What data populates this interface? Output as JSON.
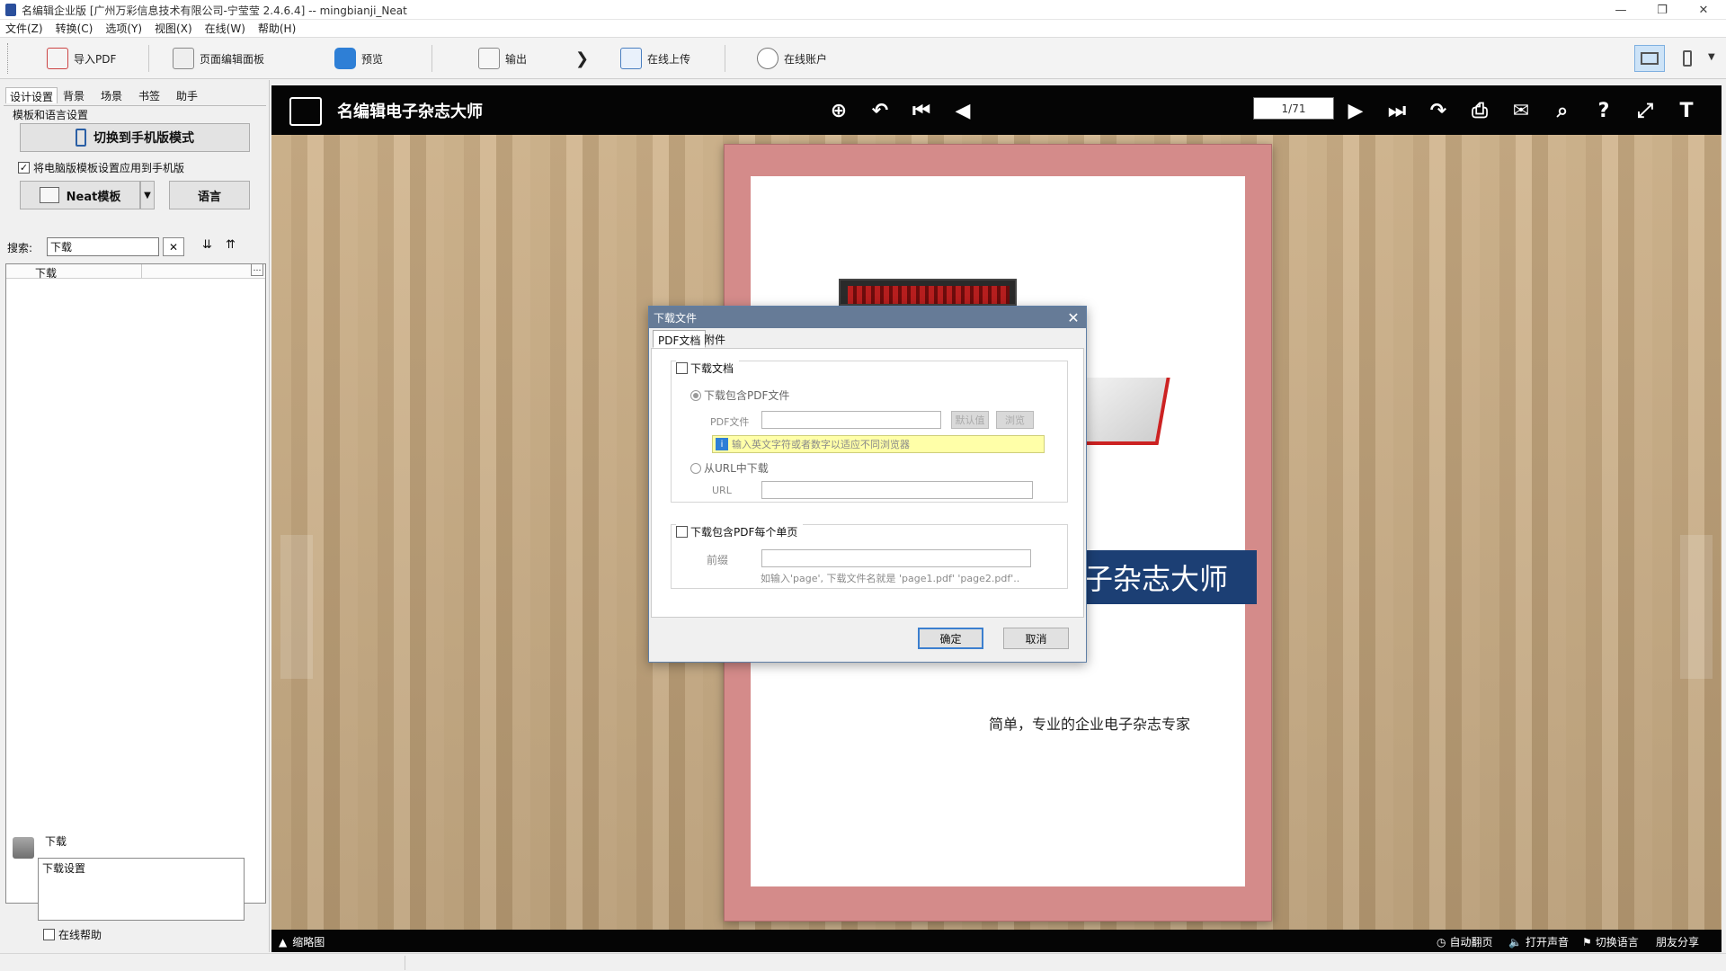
{
  "window": {
    "title": "名编辑企业版 [广州万彩信息技术有限公司-宁莹莹 2.4.6.4] -- mingbianji_Neat",
    "controls": [
      "—",
      "❐",
      "✕"
    ]
  },
  "menu": [
    "文件(Z)",
    "转换(C)",
    "选项(Y)",
    "视图(X)",
    "在线(W)",
    "帮助(H)"
  ],
  "toolbar": {
    "import_pdf": "导入PDF",
    "page_editor": "页面编辑面板",
    "preview": "预览",
    "output": "输出",
    "upload": "在线上传",
    "account": "在线账户",
    "more": "❯"
  },
  "left": {
    "tabs": [
      "设计设置",
      "背景",
      "场景",
      "书签",
      "助手"
    ],
    "group_label": "模板和语言设置",
    "switch_mobile": "切换到手机版模式",
    "apply_mobile_checkbox": "将电脑版模板设置应用到手机版",
    "template_button": "Neat模板",
    "language_button": "语言",
    "search_label": "搜索:",
    "search_value": "下载",
    "list_header": "下载",
    "list_more": "…",
    "desc_title": "下载",
    "desc_text": "下载设置",
    "online_help": "在线帮助"
  },
  "viewer": {
    "logo": "名编辑电子杂志大师",
    "page_indicator": "1/71",
    "banner": "子杂志大师",
    "subtitle": "简单，专业的企业电子杂志专家",
    "bottom": {
      "thumbnails": "缩略图",
      "autoflip": "自动翻页",
      "sound": "打开声音",
      "language": "切换语言",
      "share": "朋友分享"
    },
    "icons": [
      "zoom-in-icon",
      "undo-icon",
      "first-page-icon",
      "prev-page-icon",
      "next-page-icon",
      "last-page-icon",
      "share-icon",
      "print-icon",
      "mail-icon",
      "search-icon",
      "help-icon",
      "fullscreen-icon",
      "text-icon"
    ]
  },
  "dialog": {
    "title": "下载文件",
    "tabs": [
      "PDF文档",
      "附件"
    ],
    "download_doc": "下载文档",
    "include_pdf": "下载包含PDF文件",
    "pdf_file_label": "PDF文件",
    "default_btn": "默认值",
    "browse_btn": "浏览",
    "hint": "输入英文字符或者数字以适应不同浏览器",
    "from_url": "从URL中下载",
    "url_label": "URL",
    "include_each_page": "下载包含PDF每个单页",
    "prefix_label": "前缀",
    "prefix_hint": "如输入'page', 下载文件名就是 'page1.pdf'  'page2.pdf'..",
    "ok": "确定",
    "cancel": "取消"
  },
  "colors": {
    "accent": "#3b7fcf",
    "dialog_title": "#667b97",
    "book_cover": "#d48b8a",
    "banner": "#1c3f74"
  }
}
